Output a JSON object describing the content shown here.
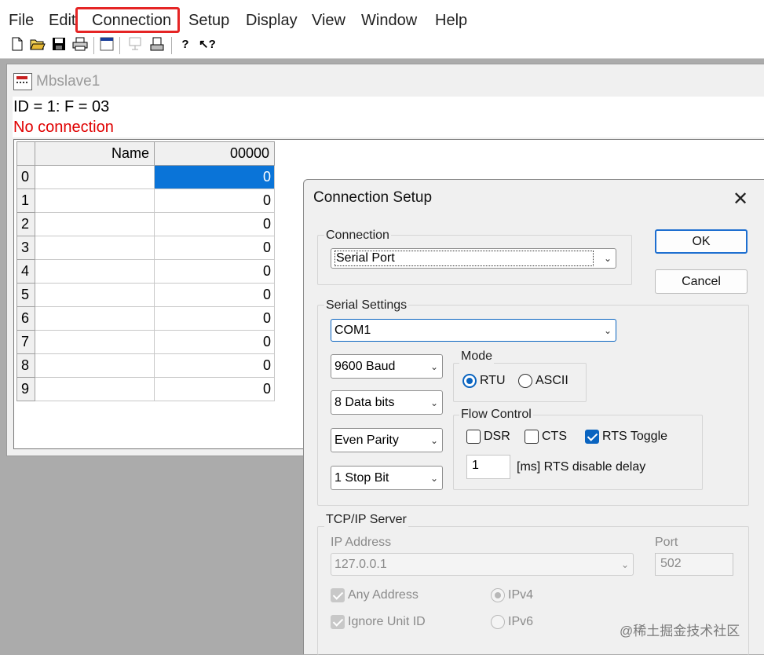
{
  "menubar": {
    "file": "File",
    "edit": "Edit",
    "connection": "Connection",
    "setup": "Setup",
    "display": "Display",
    "view": "View",
    "window": "Window",
    "help": "Help"
  },
  "toolbar": {
    "icons": [
      "new-document-icon",
      "open-folder-icon",
      "save-icon",
      "print-icon",
      "window-icon",
      "disabled-doc-icon",
      "printer-doc-icon",
      "help-icon",
      "context-help-icon"
    ]
  },
  "child_window": {
    "title": "Mbslave1",
    "id_line": "ID = 1: F = 03",
    "status": "No connection",
    "grid": {
      "header_name": "Name",
      "header_addr": "00000",
      "rows": [
        {
          "index": "0",
          "name": "",
          "value": "0",
          "selected": true
        },
        {
          "index": "1",
          "name": "",
          "value": "0"
        },
        {
          "index": "2",
          "name": "",
          "value": "0"
        },
        {
          "index": "3",
          "name": "",
          "value": "0"
        },
        {
          "index": "4",
          "name": "",
          "value": "0"
        },
        {
          "index": "5",
          "name": "",
          "value": "0"
        },
        {
          "index": "6",
          "name": "",
          "value": "0"
        },
        {
          "index": "7",
          "name": "",
          "value": "0"
        },
        {
          "index": "8",
          "name": "",
          "value": "0"
        },
        {
          "index": "9",
          "name": "",
          "value": "0"
        }
      ]
    }
  },
  "dialog": {
    "title": "Connection Setup",
    "ok": "OK",
    "cancel": "Cancel",
    "connection_group": "Connection",
    "connection_value": "Serial Port",
    "serial_group": "Serial Settings",
    "com_port": "COM1",
    "baud": "9600 Baud",
    "data_bits": "8 Data bits",
    "parity": "Even Parity",
    "stop_bits": "1 Stop Bit",
    "mode_group": "Mode",
    "mode_rtu": "RTU",
    "mode_ascii": "ASCII",
    "mode_selected": "RTU",
    "flow_group": "Flow Control",
    "flow_dsr": "DSR",
    "flow_cts": "CTS",
    "flow_rts_toggle": "RTS Toggle",
    "rts_delay_value": "1",
    "rts_delay_label": "[ms] RTS disable delay",
    "tcp_group": "TCP/IP Server",
    "ip_label": "IP Address",
    "ip_value": "127.0.0.1",
    "port_label": "Port",
    "port_value": "502",
    "any_address": "Any Address",
    "ignore_unit_id": "Ignore Unit ID",
    "ipv4": "IPv4",
    "ipv6": "IPv6"
  },
  "watermark": "@稀土掘金技术社区",
  "colors": {
    "highlight_border": "#e52525",
    "selection": "#0a74d8",
    "status_red": "#e00000",
    "accent": "#0a64c0"
  }
}
